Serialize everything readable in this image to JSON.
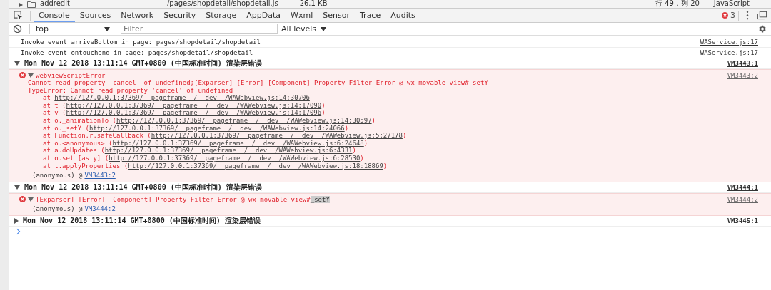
{
  "top_strip": {
    "tree_item": "addredit",
    "file_path": "/pages/shopdetail/shopdetail.js",
    "file_size": "26.1 KB",
    "cursor_position": "行 49，列 20",
    "language": "JavaScript"
  },
  "tabs": [
    {
      "label": "Console",
      "selected": true
    },
    {
      "label": "Sources",
      "selected": false
    },
    {
      "label": "Network",
      "selected": false
    },
    {
      "label": "Security",
      "selected": false
    },
    {
      "label": "Storage",
      "selected": false
    },
    {
      "label": "AppData",
      "selected": false
    },
    {
      "label": "Wxml",
      "selected": false
    },
    {
      "label": "Sensor",
      "selected": false
    },
    {
      "label": "Trace",
      "selected": false
    },
    {
      "label": "Audits",
      "selected": false
    }
  ],
  "error_count": "3",
  "filter": {
    "context": "top",
    "placeholder": "Filter",
    "levels": "All levels"
  },
  "messages": [
    {
      "kind": "log",
      "text": "Invoke event arriveBottom in page: pages/shopdetail/shopdetail",
      "source": "WAService.js:17"
    },
    {
      "kind": "log",
      "text": "Invoke event ontouchend in page: pages/shopdetail/shopdetail",
      "source": "WAService.js:17"
    },
    {
      "kind": "group",
      "text": "Mon Nov 12 2018 13:11:14 GMT+0800 (中国标准时间) 渲染层错误",
      "source": "VM3443:1",
      "expanded": true,
      "children": [
        {
          "title": "webviewScriptError",
          "source": "VM3443:2",
          "expanded": true,
          "lines": [
            "Cannot read property 'cancel' of undefined;[Exparser] [Error] [Component] Property Filter Error @ wx-movable-view#_setY",
            "TypeError: Cannot read property 'cancel' of undefined"
          ],
          "stack": [
            {
              "text": "at ",
              "link": "http://127.0.0.1:37369/__pageframe__/__dev__/WAWebview.js:14:30706"
            },
            {
              "text": "at t (",
              "link": "http://127.0.0.1:37369/__pageframe__/__dev__/WAWebview.js:14:17090",
              "tail": ")"
            },
            {
              "text": "at v (",
              "link": "http://127.0.0.1:37369/__pageframe__/__dev__/WAWebview.js:14:17096",
              "tail": ")"
            },
            {
              "text": "at o._animationTo (",
              "link": "http://127.0.0.1:37369/__pageframe__/__dev__/WAWebview.js:14:30597",
              "tail": ")"
            },
            {
              "text": "at o._setY (",
              "link": "http://127.0.0.1:37369/__pageframe__/__dev__/WAWebview.js:14:24066",
              "tail": ")"
            },
            {
              "text": "at Function.r.safeCallback (",
              "link": "http://127.0.0.1:37369/__pageframe__/__dev__/WAWebview.js:5:27178",
              "tail": ")"
            },
            {
              "text": "at o.<anonymous> (",
              "link": "http://127.0.0.1:37369/__pageframe__/__dev__/WAWebview.js:6:24648",
              "tail": ")"
            },
            {
              "text": "at a.doUpdates (",
              "link": "http://127.0.0.1:37369/__pageframe__/__dev__/WAWebview.js:6:4331",
              "tail": ")"
            },
            {
              "text": "at o.set [as y] (",
              "link": "http://127.0.0.1:37369/__pageframe__/__dev__/WAWebview.js:6:28530",
              "tail": ")"
            },
            {
              "text": "at t.applyProperties (",
              "link": "http://127.0.0.1:37369/__pageframe__/__dev__/WAWebview.js:18:18869",
              "tail": ")"
            }
          ],
          "trailer": {
            "text": "(anonymous) @",
            "link": "VM3443:2"
          }
        }
      ]
    },
    {
      "kind": "group",
      "text": "Mon Nov 12 2018 13:11:14 GMT+0800 (中国标准时间) 渲染层错误",
      "source": "VM3444:1",
      "expanded": true,
      "children": [
        {
          "title": "[Exparser] [Error] [Component] Property Filter Error @ wx-movable-view#",
          "highlighted": "_setY",
          "source": "VM3444:2",
          "expanded": true,
          "trailer": {
            "text": "(anonymous) @",
            "link": "VM3444:2"
          }
        }
      ]
    },
    {
      "kind": "group",
      "text": "Mon Nov 12 2018 13:11:14 GMT+0800 (中国标准时间) 渲染层错误",
      "source": "VM3445:1",
      "expanded": false
    }
  ]
}
